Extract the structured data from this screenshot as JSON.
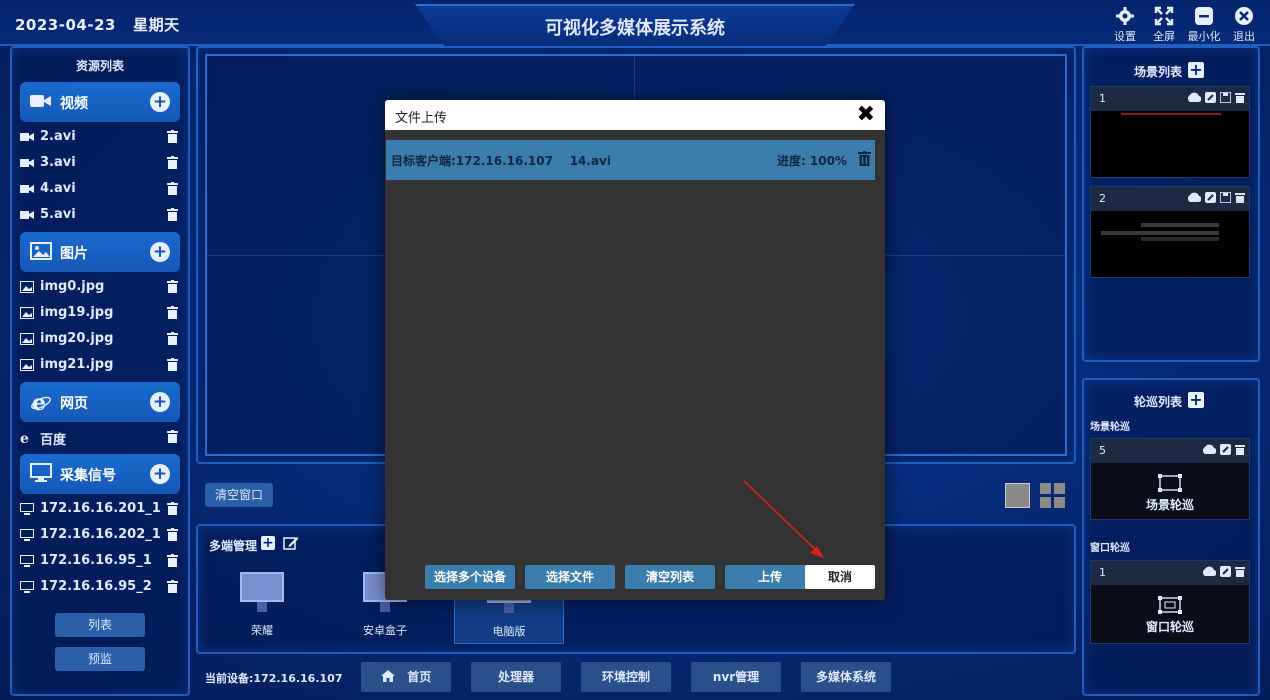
{
  "header": {
    "date": "2023-04-23",
    "weekday": "星期天",
    "title": "可视化多媒体展示系统",
    "buttons": [
      {
        "icon": "gear-icon",
        "label": "设置"
      },
      {
        "icon": "fullscreen-icon",
        "label": "全屏"
      },
      {
        "icon": "minimize-icon",
        "label": "最小化"
      },
      {
        "icon": "exit-icon",
        "label": "退出"
      }
    ]
  },
  "left": {
    "title": "资源列表",
    "sections": {
      "video": {
        "label": "视频",
        "items": [
          "2.avi",
          "3.avi",
          "4.avi",
          "5.avi"
        ]
      },
      "image": {
        "label": "图片",
        "items": [
          "img0.jpg",
          "img19.jpg",
          "img20.jpg",
          "img21.jpg"
        ]
      },
      "web": {
        "label": "网页",
        "items": [
          "百度"
        ]
      },
      "capture": {
        "label": "采集信号",
        "items": [
          "172.16.16.201_1",
          "172.16.16.202_1",
          "172.16.16.95_1",
          "172.16.16.95_2"
        ]
      }
    },
    "list_button": "列表",
    "preview_button": "预监"
  },
  "center": {
    "clear_window": "清空窗口",
    "multi_title": "多端管理",
    "devices": [
      "荣耀",
      "安卓盒子",
      "电脑版"
    ],
    "current_device": "当前设备:172.16.16.107",
    "nav": [
      "首页",
      "处理器",
      "环境控制",
      "nvr管理",
      "多媒体系统"
    ]
  },
  "right": {
    "scene_title": "场景列表",
    "scenes": [
      {
        "num": "1"
      },
      {
        "num": "2"
      }
    ],
    "tour_title": "轮巡列表",
    "scene_tour_label": "场景轮巡",
    "scene_tour": {
      "num": "5",
      "name": "场景轮巡"
    },
    "window_tour_label": "窗口轮巡",
    "window_tour": {
      "num": "1",
      "name": "窗口轮巡"
    }
  },
  "modal": {
    "title": "文件上传",
    "row": {
      "target": "目标客户端:172.16.16.107",
      "file": "14.avi",
      "progress": "进度: 100%"
    },
    "buttons": {
      "multi": "选择多个设备",
      "file": "选择文件",
      "clear": "清空列表",
      "upload": "上传",
      "cancel": "取消"
    }
  },
  "colors": {
    "accent": "#1558b6",
    "modal_row": "#3b7eae",
    "annotation": "#e02020"
  }
}
